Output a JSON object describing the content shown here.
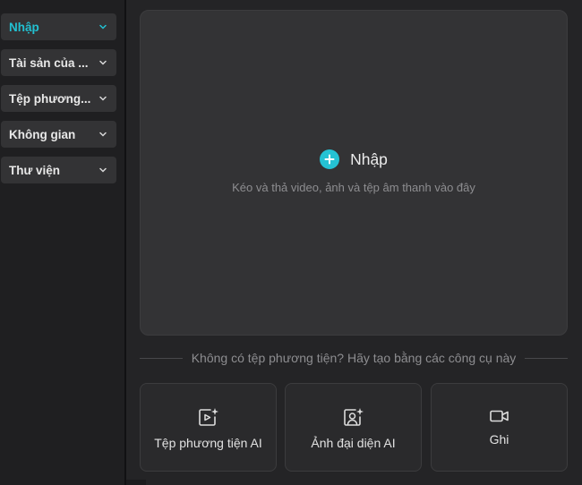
{
  "sidebar": {
    "items": [
      {
        "label": "Nhập",
        "active": true
      },
      {
        "label": "Tài sản của ..."
      },
      {
        "label": "Tệp phương..."
      },
      {
        "label": "Không gian"
      },
      {
        "label": "Thư viện"
      }
    ]
  },
  "main": {
    "import_label": "Nhập",
    "import_hint": "Kéo và thả video, ảnh và tệp âm thanh vào đây",
    "divider_text": "Không có tệp phương tiện? Hãy tạo bằng các công cụ này",
    "tools": [
      {
        "label": "Tệp phương tiện AI",
        "icon": "ai-media-icon"
      },
      {
        "label": "Ảnh đại diện AI",
        "icon": "ai-avatar-icon"
      },
      {
        "label": "Ghi",
        "icon": "record-camera-icon"
      }
    ]
  },
  "colors": {
    "accent": "#22c0d1",
    "background": "#242426",
    "panel": "#333335"
  }
}
